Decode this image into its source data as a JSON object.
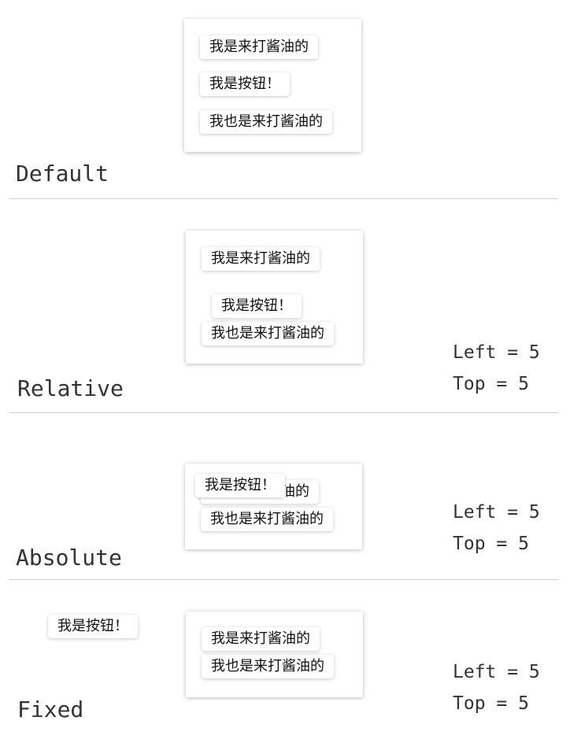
{
  "items": {
    "first": "我是来打酱油的",
    "button": "我是按钮！",
    "second": "我也是来打酱油的"
  },
  "sections": {
    "default": {
      "label": "Default"
    },
    "relative": {
      "label": "Relative",
      "left": "Left = 5",
      "top": "Top = 5"
    },
    "absolute": {
      "label": "Absolute",
      "left": "Left = 5",
      "top": "Top = 5"
    },
    "fixed": {
      "label": "Fixed",
      "left": "Left = 5",
      "top": "Top = 5"
    }
  }
}
